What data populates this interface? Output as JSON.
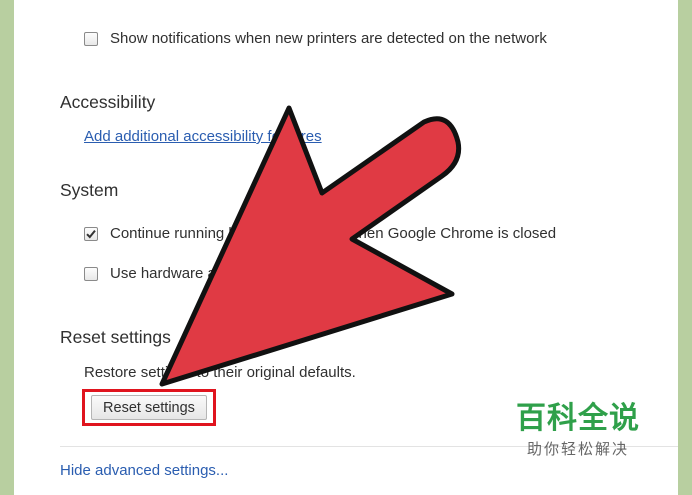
{
  "printers": {
    "notify_label": "Show notifications when new printers are detected on the network",
    "notify_checked": false
  },
  "accessibility": {
    "title": "Accessibility",
    "link_label": "Add additional accessibility features"
  },
  "system": {
    "title": "System",
    "options": [
      {
        "label": "Continue running background apps when Google Chrome is closed",
        "checked": true
      },
      {
        "label": "Use hardware acceleration when available",
        "checked": false
      }
    ]
  },
  "reset": {
    "title": "Reset settings",
    "description": "Restore settings to their original defaults.",
    "button_label": "Reset settings"
  },
  "footer": {
    "hide_advanced_label": "Hide advanced settings..."
  },
  "watermark": {
    "title": "百科全说",
    "subtitle": "助你轻松解决"
  },
  "colors": {
    "arrow_fill": "#e03a44",
    "highlight_border": "#e0141e",
    "link": "#2a5db0",
    "watermark_green": "#2fa04a",
    "background_frame": "#b8cfa0"
  },
  "icons": {
    "arrow": "red-arrow-icon",
    "checkmark": "checkmark-icon"
  }
}
